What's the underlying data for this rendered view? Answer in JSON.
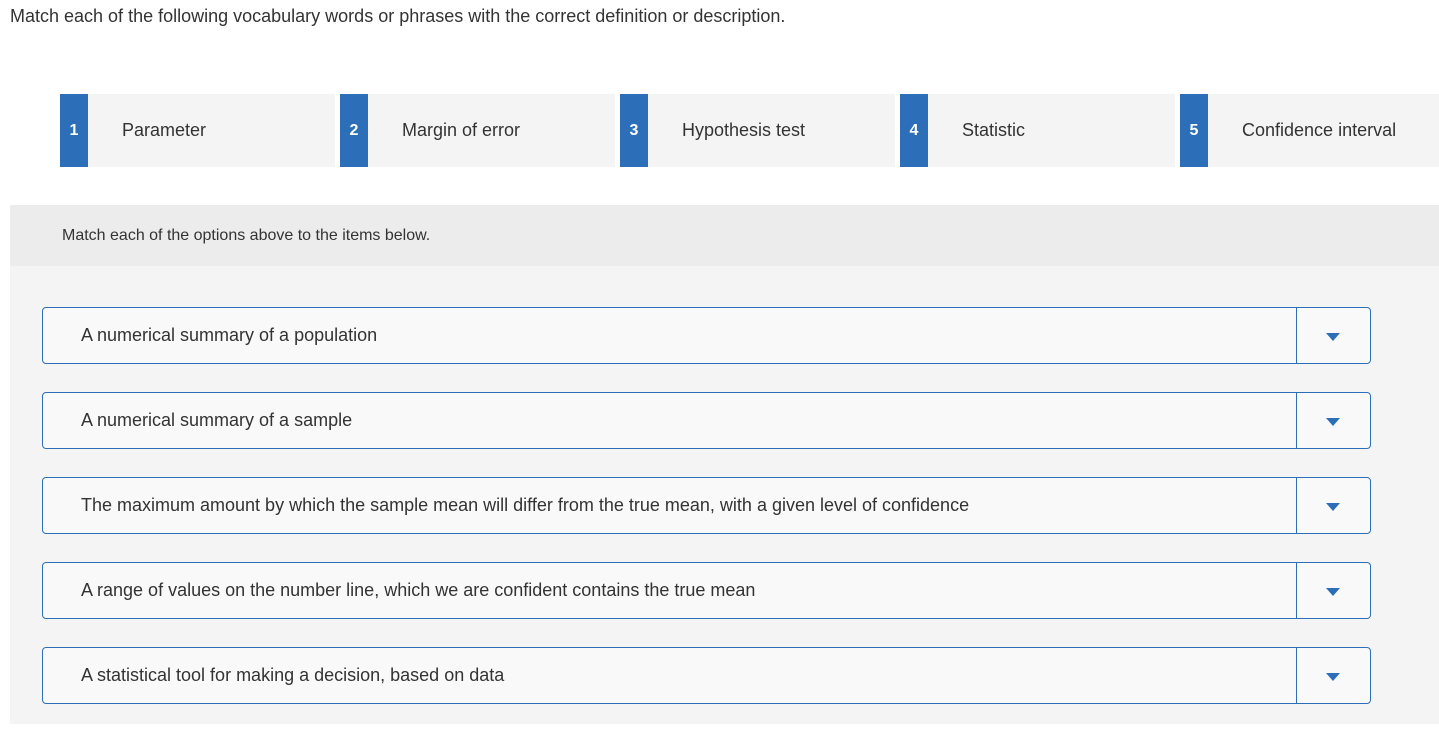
{
  "instructions": "Match each of the following vocabulary words or phrases with the correct definition or description.",
  "options": [
    {
      "number": "1",
      "label": "Parameter"
    },
    {
      "number": "2",
      "label": "Margin of error"
    },
    {
      "number": "3",
      "label": "Hypothesis test"
    },
    {
      "number": "4",
      "label": "Statistic"
    },
    {
      "number": "5",
      "label": "Confidence interval"
    }
  ],
  "match_section": {
    "header": "Match each of the options above to the items below.",
    "items": [
      {
        "text": "A numerical summary of a population",
        "selected": ""
      },
      {
        "text": "A numerical summary of a sample",
        "selected": ""
      },
      {
        "text": "The maximum amount by which the sample mean will differ from the true mean, with a given level of confidence",
        "selected": ""
      },
      {
        "text": "A range of values on the number line, which we are confident contains the true mean",
        "selected": ""
      },
      {
        "text": "A statistical tool for making a decision, based on data",
        "selected": ""
      }
    ]
  },
  "colors": {
    "accent": "#2c6fb8",
    "option_bg": "#f4f4f4",
    "panel_bg": "#f4f4f4",
    "panel_header_bg": "#ececec",
    "text": "#333333"
  },
  "icons": {
    "dropdown": "caret-down-icon"
  }
}
